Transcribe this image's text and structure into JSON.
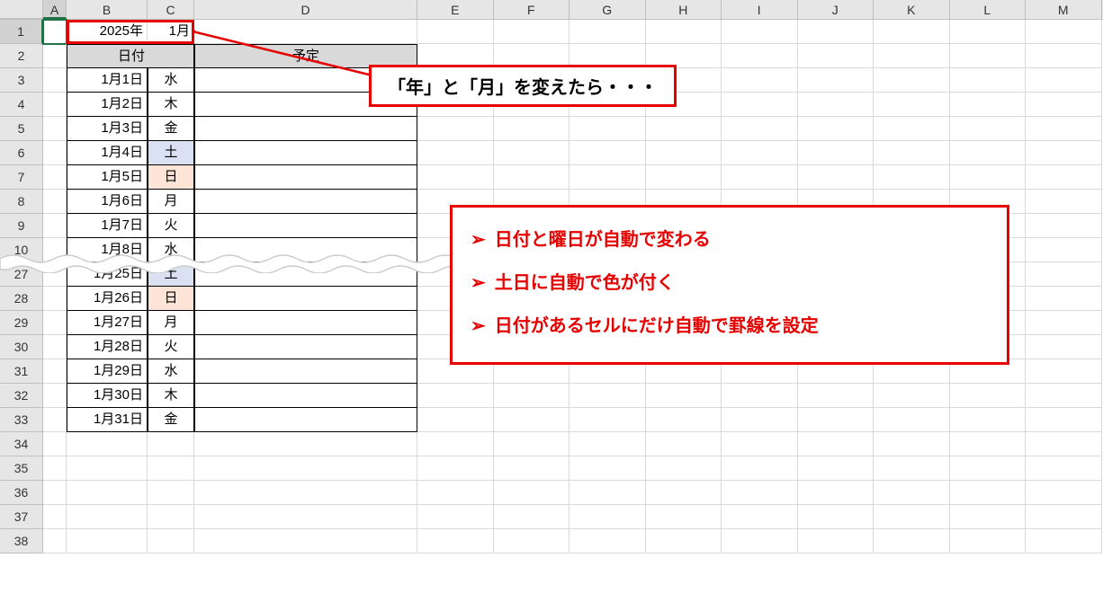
{
  "columns": [
    "A",
    "B",
    "C",
    "D",
    "E",
    "F",
    "G",
    "H",
    "I",
    "J",
    "K",
    "L",
    "M"
  ],
  "row_headers_top": [
    "1",
    "2",
    "3",
    "4",
    "5",
    "6",
    "7",
    "8",
    "9",
    "10"
  ],
  "row_headers_bottom": [
    "27",
    "28",
    "29",
    "30",
    "31",
    "32",
    "33",
    "34",
    "35",
    "36",
    "37",
    "38"
  ],
  "year_cell": "2025年",
  "month_cell": "1月",
  "header_date": "日付",
  "header_plan": "予定",
  "rows_top": [
    {
      "date": "1月1日",
      "dow": "水",
      "dow_class": ""
    },
    {
      "date": "1月2日",
      "dow": "木",
      "dow_class": ""
    },
    {
      "date": "1月3日",
      "dow": "金",
      "dow_class": ""
    },
    {
      "date": "1月4日",
      "dow": "土",
      "dow_class": "satbg"
    },
    {
      "date": "1月5日",
      "dow": "日",
      "dow_class": "sunbg"
    },
    {
      "date": "1月6日",
      "dow": "月",
      "dow_class": ""
    },
    {
      "date": "1月7日",
      "dow": "火",
      "dow_class": ""
    },
    {
      "date": "1月8日",
      "dow": "水",
      "dow_class": ""
    }
  ],
  "rows_bottom": [
    {
      "date": "1月25日",
      "dow": "土",
      "dow_class": "satbg"
    },
    {
      "date": "1月26日",
      "dow": "日",
      "dow_class": "sunbg"
    },
    {
      "date": "1月27日",
      "dow": "月",
      "dow_class": ""
    },
    {
      "date": "1月28日",
      "dow": "火",
      "dow_class": ""
    },
    {
      "date": "1月29日",
      "dow": "水",
      "dow_class": ""
    },
    {
      "date": "1月30日",
      "dow": "木",
      "dow_class": ""
    },
    {
      "date": "1月31日",
      "dow": "金",
      "dow_class": ""
    }
  ],
  "callout_text": "「年」と「月」を変えたら・・・",
  "features": [
    "日付と曜日が自動で変わる",
    "土日に自動で色が付く",
    "日付があるセルにだけ自動で罫線を設定"
  ],
  "bullet_glyph": "➢"
}
